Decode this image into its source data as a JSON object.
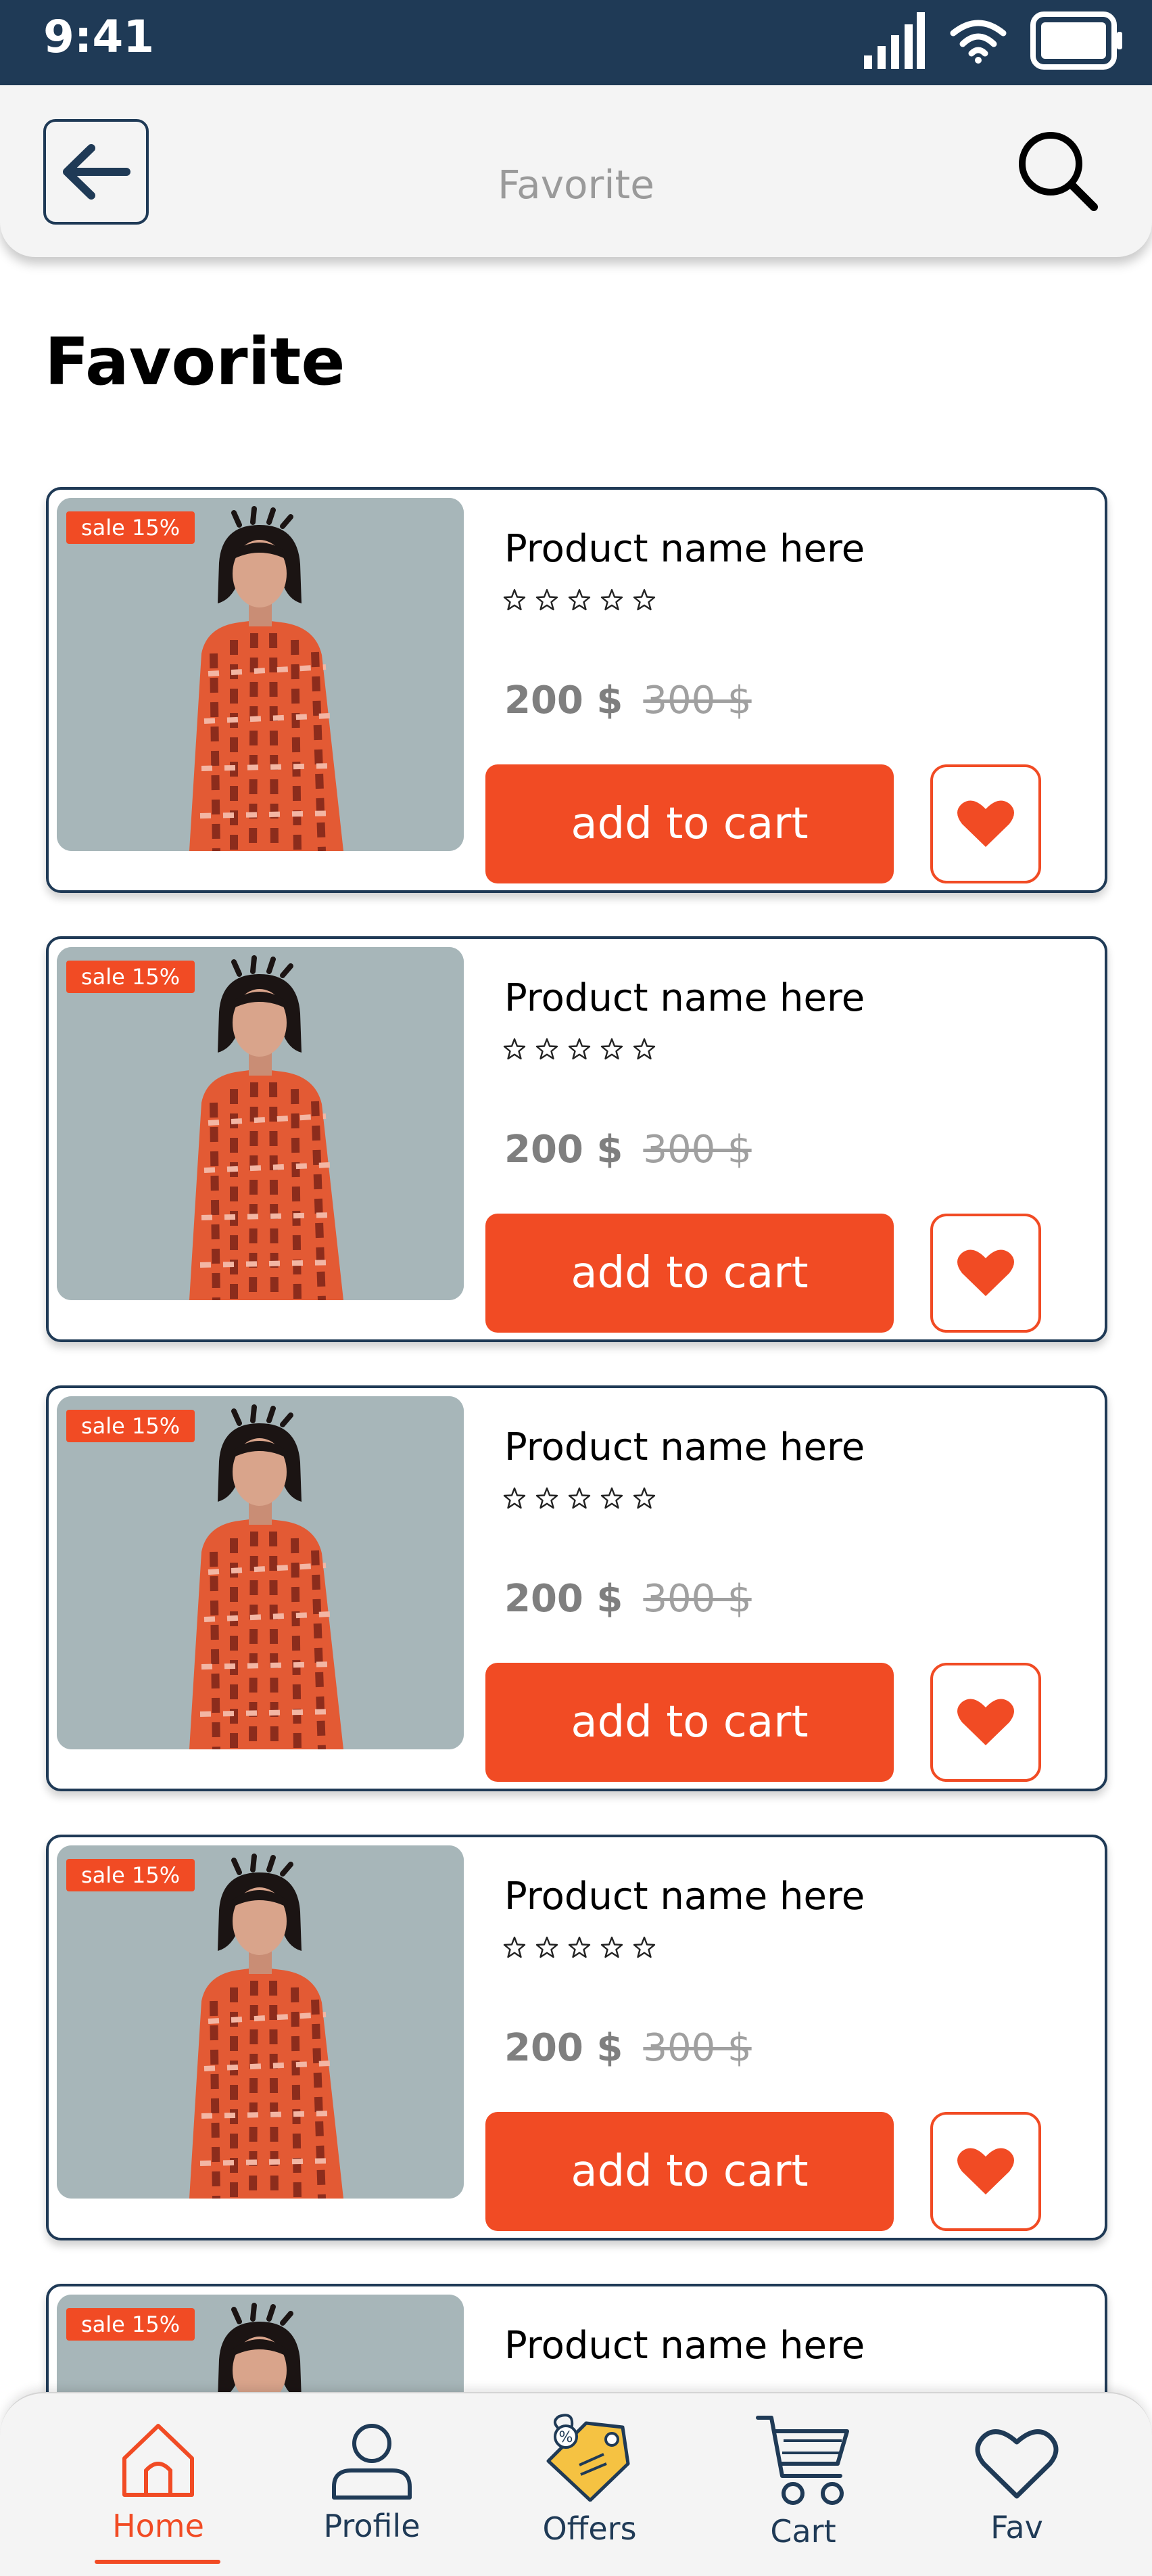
{
  "status_bar": {
    "time": "9:41"
  },
  "header": {
    "title": "Favorite"
  },
  "page_title": "Favorite",
  "products": [
    {
      "sale": "sale 15%",
      "name": "Product name here",
      "price": "200 $",
      "old_price": "300 $",
      "rating": 0,
      "cta": "add to cart"
    },
    {
      "sale": "sale 15%",
      "name": "Product name here",
      "price": "200 $",
      "old_price": "300 $",
      "rating": 0,
      "cta": "add to cart"
    },
    {
      "sale": "sale 15%",
      "name": "Product name here",
      "price": "200 $",
      "old_price": "300 $",
      "rating": 0,
      "cta": "add to cart"
    },
    {
      "sale": "sale 15%",
      "name": "Product name here",
      "price": "200 $",
      "old_price": "300 $",
      "rating": 0,
      "cta": "add to cart"
    },
    {
      "sale": "sale 15%",
      "name": "Product name here"
    }
  ],
  "nav": [
    {
      "label": "Home",
      "icon": "home-icon",
      "active": true
    },
    {
      "label": "Profile",
      "icon": "profile-icon"
    },
    {
      "label": "Offers",
      "icon": "offers-tag-icon"
    },
    {
      "label": "Cart",
      "icon": "cart-icon"
    },
    {
      "label": "Fav",
      "icon": "heart-icon"
    }
  ],
  "colors": {
    "primary": "#1f3a56",
    "accent": "#f14b24",
    "header_bg": "#f4f4f4"
  }
}
